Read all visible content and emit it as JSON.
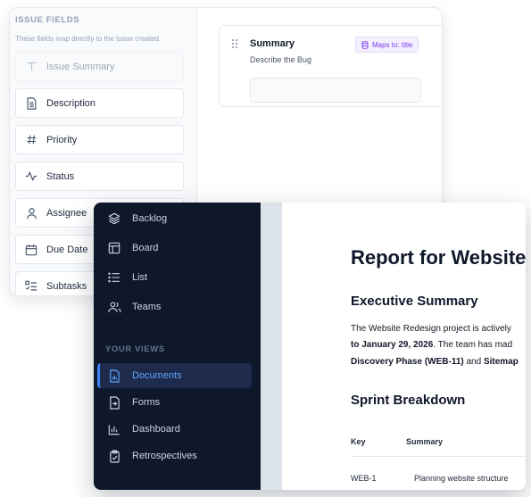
{
  "issue_fields": {
    "heading": "ISSUE FIELDS",
    "subtitle": "These fields map directly to the Issue created.",
    "items": [
      {
        "label": "Issue Summary",
        "icon": "text-t-icon",
        "disabled": true
      },
      {
        "label": "Description",
        "icon": "document-icon",
        "disabled": false
      },
      {
        "label": "Priority",
        "icon": "hash-icon",
        "disabled": false
      },
      {
        "label": "Status",
        "icon": "activity-icon",
        "disabled": false
      },
      {
        "label": "Assignee",
        "icon": "user-icon",
        "disabled": false
      },
      {
        "label": "Due Date",
        "icon": "calendar-icon",
        "disabled": false
      },
      {
        "label": "Subtasks",
        "icon": "checklist-icon",
        "disabled": false
      }
    ]
  },
  "form_canvas": {
    "field_title": "Summary",
    "field_description": "Describe the Bug",
    "badge": "Maps to: title",
    "badge_color": "#7c3aed"
  },
  "sidebar": {
    "top_items": [
      {
        "label": "Backlog",
        "icon": "layers-icon"
      },
      {
        "label": "Board",
        "icon": "board-icon"
      },
      {
        "label": "List",
        "icon": "list-icon"
      },
      {
        "label": "Teams",
        "icon": "users-icon"
      }
    ],
    "section_label": "YOUR VIEWS",
    "view_items": [
      {
        "label": "Documents",
        "icon": "document-chart-icon",
        "active": true
      },
      {
        "label": "Forms",
        "icon": "form-icon",
        "active": false
      },
      {
        "label": "Dashboard",
        "icon": "bar-chart-icon",
        "active": false
      },
      {
        "label": "Retrospectives",
        "icon": "clipboard-check-icon",
        "active": false
      }
    ],
    "active_color": "#60a5fa"
  },
  "report": {
    "title": "Report for Website",
    "exec_heading": "Executive Summary",
    "p1": "The Website Redesign project is actively",
    "p2_bold": "to January 29, 2026",
    "p2_rest": ". The team has mad",
    "p3_bold1": "Discovery Phase (WEB-11)",
    "p3_mid": " and ",
    "p3_bold2": "Sitemap",
    "sprint_heading": "Sprint Breakdown",
    "table": {
      "headers": [
        "Key",
        "Summary"
      ],
      "rows": [
        [
          "WEB-1",
          "Planning website structure"
        ]
      ]
    }
  }
}
